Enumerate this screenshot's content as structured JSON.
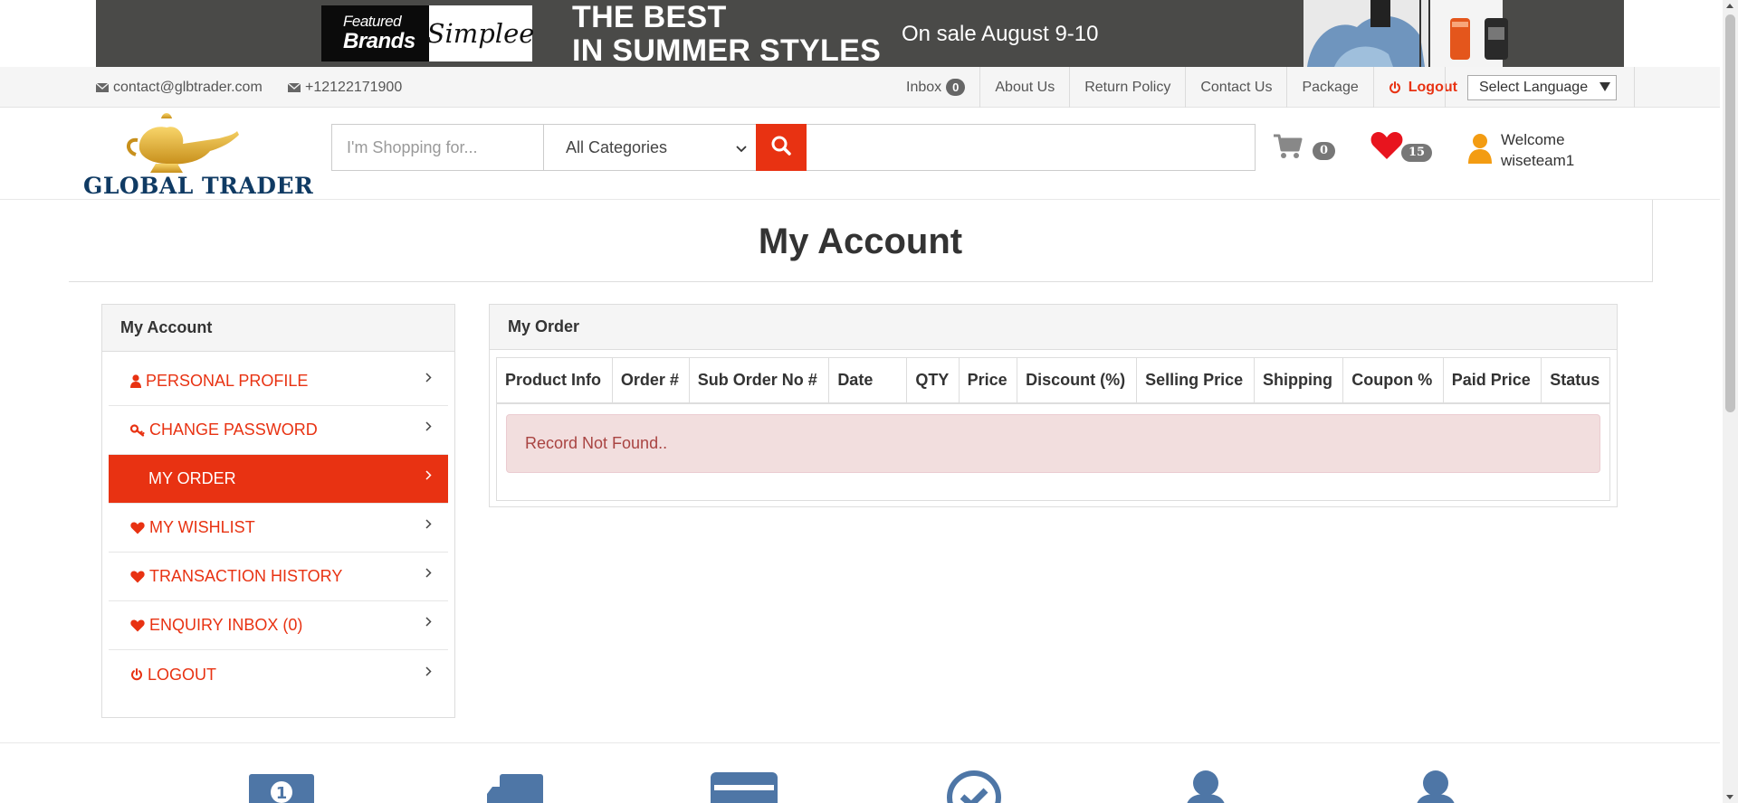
{
  "banner": {
    "featured_line1": "Featured",
    "featured_line2": "Brands",
    "brand_name": "Simplee",
    "headline_line1": "THE BEST",
    "headline_line2": "IN SUMMER STYLES",
    "sale_text": "On sale August 9-10"
  },
  "topbar": {
    "email": "contact@glbtrader.com",
    "phone": "+12122171900",
    "inbox_label": "Inbox",
    "inbox_count": "0",
    "nav": [
      "About Us",
      "Return Policy",
      "Contact Us",
      "Package"
    ],
    "logout_label": "Logout",
    "language_select": "Select Language"
  },
  "header": {
    "logo_text": "GLOBAL TRADER",
    "search_placeholder": "I'm Shopping for...",
    "category_selected": "All Categories",
    "cart_count": "0",
    "wishlist_count": "15",
    "welcome_label": "Welcome",
    "username": "wiseteam1"
  },
  "page": {
    "title": "My Account"
  },
  "sidebar": {
    "title": "My Account",
    "items": [
      {
        "label": "PERSONAL PROFILE",
        "icon": "user-icon"
      },
      {
        "label": "CHANGE PASSWORD",
        "icon": "key-icon"
      },
      {
        "label": "MY ORDER",
        "icon": "",
        "active": true
      },
      {
        "label": "MY WISHLIST",
        "icon": "heart-icon"
      },
      {
        "label": "TRANSACTION HISTORY",
        "icon": "heart-icon"
      },
      {
        "label": "ENQUIRY INBOX (0)",
        "icon": "heart-icon"
      },
      {
        "label": "LOGOUT",
        "icon": "power-icon"
      }
    ]
  },
  "orders": {
    "title": "My Order",
    "columns": [
      "Product Info",
      "Order #",
      "Sub Order No #",
      "Date",
      "QTY",
      "Price",
      "Discount (%)",
      "Selling Price",
      "Shipping",
      "Coupon %",
      "Paid Price",
      "Status"
    ],
    "empty_message": "Record Not Found.."
  },
  "colors": {
    "accent": "#e83212",
    "brand_navy": "#0f3a63",
    "user_orange": "#f39c12",
    "feature_blue": "#4e76a6"
  }
}
